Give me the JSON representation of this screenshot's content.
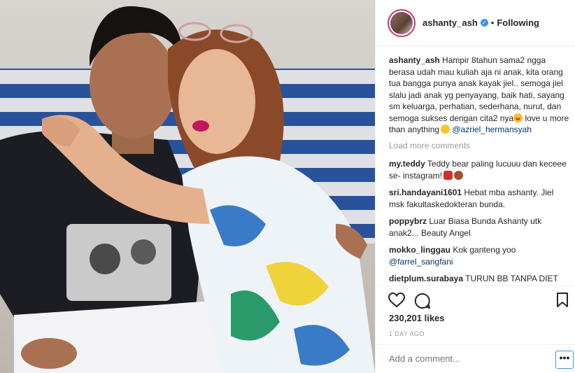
{
  "header": {
    "username": "ashanty_ash",
    "separator": "•",
    "follow_status": "Following"
  },
  "caption": {
    "username": "ashanty_ash",
    "text": "Hampir 8tahun sama2 ngga berasa udah mau kuliah aja ni anak, kita orang tua bangga punya anak kayak jiel.. semoga jiel slalu jadi anak yg penyayang, baik hati, sayang sm keluarga, perhatian, sederhana, nurut, dan semoga sukses dengan cita2 nya",
    "text_2": " love u more than anything",
    "mention": "@azriel_hermansyah"
  },
  "load_more": "Load more comments",
  "comments": [
    {
      "username": "my.teddy",
      "text": "Teddy bear paling lucuuu dan keceee se- instagram!"
    },
    {
      "username": "sri.handayani1601",
      "text": "Hebat mba ashanty. Jiel msk fakultaskedokteran bunda."
    },
    {
      "username": "poppybrz",
      "text": "Luar Biasa Bunda Ashanty utk anak2... Beauty Angel"
    },
    {
      "username": "mokko_linggau",
      "text": "Kok ganteng yoo",
      "mention": "@farrel_sangfani"
    },
    {
      "username": "dietplum.surabaya",
      "text": "TURUN BB TANPA DIET"
    }
  ],
  "likes": "230,201 likes",
  "time_ago": "1 DAY AGO",
  "add_comment": {
    "placeholder": "Add a comment..."
  },
  "more_options": "•••",
  "icons": {
    "like": "heart-outline-icon",
    "comment": "speech-bubble-icon",
    "save": "bookmark-icon",
    "verified": "verified-badge-icon"
  },
  "colors": {
    "text": "#262626",
    "muted": "#999999",
    "mention": "#003569",
    "verified": "#3897f0",
    "border": "#efefef"
  }
}
